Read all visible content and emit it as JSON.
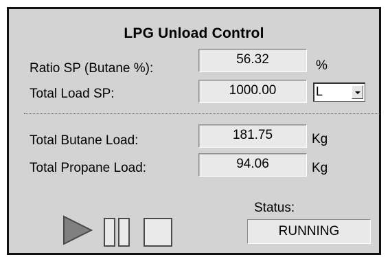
{
  "panel": {
    "title": "LPG Unload Control"
  },
  "setpoints": {
    "ratio": {
      "label": "Ratio SP (Butane %):",
      "value": "56.32",
      "unit": "%"
    },
    "total_load": {
      "label": "Total Load SP:",
      "value": "1000.00",
      "unit_selected": "L"
    }
  },
  "loads": {
    "butane": {
      "label": "Total Butane Load:",
      "value": "181.75",
      "unit": "Kg"
    },
    "propane": {
      "label": "Total Propane Load:",
      "value": "94.06",
      "unit": "Kg"
    }
  },
  "controls": {
    "play_icon": "play-icon",
    "pause_icon": "pause-icon",
    "stop_icon": "stop-icon"
  },
  "status": {
    "label": "Status:",
    "value": "RUNNING"
  },
  "colors": {
    "panel_bg": "#d3d3d3",
    "field_bg": "#e9e9e9",
    "icon_stroke": "#4a4a4a",
    "play_fill": "#808080"
  }
}
